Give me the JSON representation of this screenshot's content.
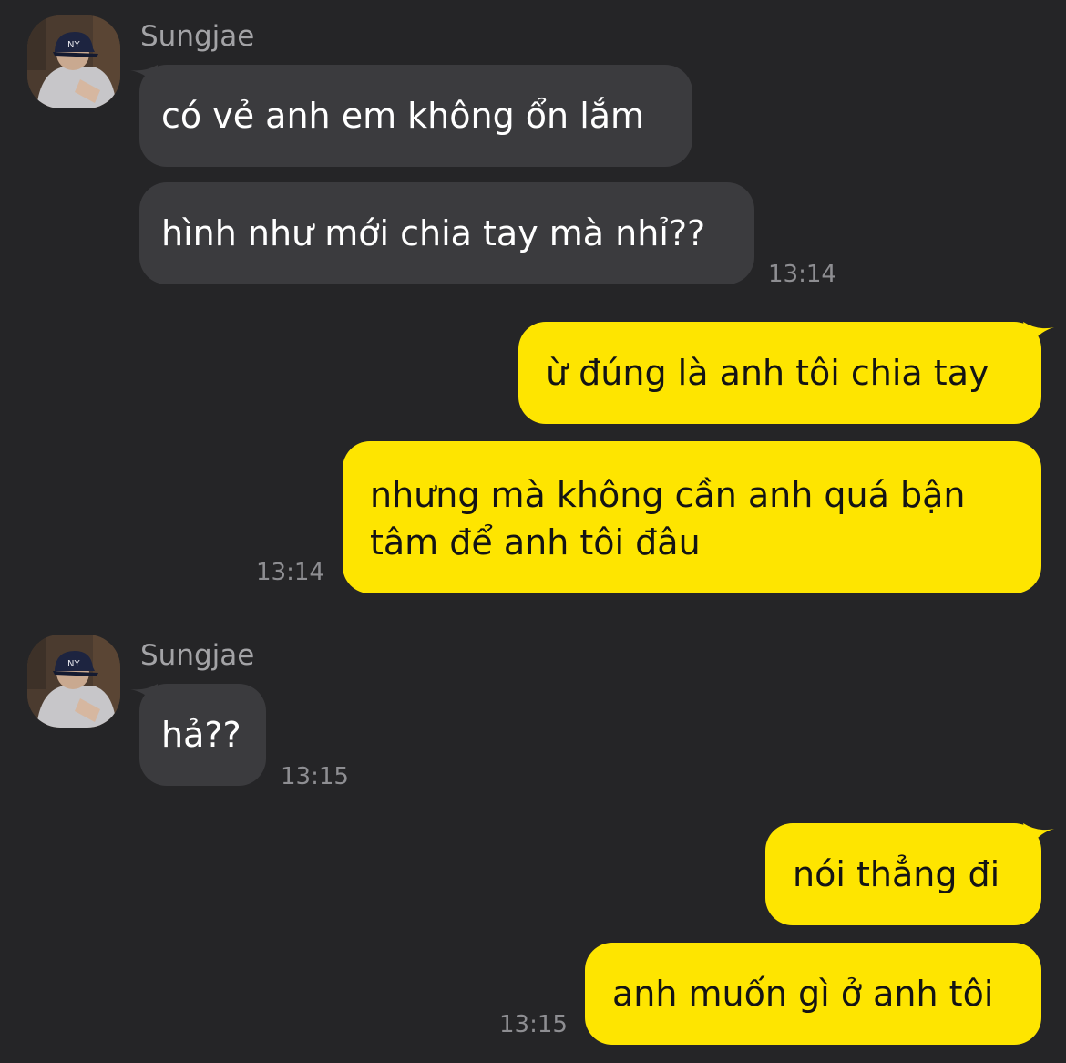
{
  "colors": {
    "background": "#252527",
    "incoming_bubble": "#3b3b3e",
    "outgoing_bubble": "#fee500",
    "timestamp": "#8e8e92",
    "sender_name": "#a3a3a6"
  },
  "messages": [
    {
      "sender": "Sungjae",
      "avatar_icon": "user-avatar-photo",
      "texts": [
        "có vẻ anh em không ổn lắm",
        "hình như mới chia tay mà nhỉ??"
      ],
      "time": "13:14"
    },
    {
      "sender": "me",
      "texts": [
        "ừ đúng là anh tôi chia tay",
        "nhưng mà không cần anh quá bận",
        "tâm để anh tôi đâu"
      ],
      "time": "13:14"
    },
    {
      "sender": "Sungjae",
      "avatar_icon": "user-avatar-photo",
      "texts": [
        "hả??"
      ],
      "time": "13:15"
    },
    {
      "sender": "me",
      "texts": [
        "nói thẳng đi",
        "anh muốn gì ở anh tôi"
      ],
      "time": "13:15"
    }
  ]
}
